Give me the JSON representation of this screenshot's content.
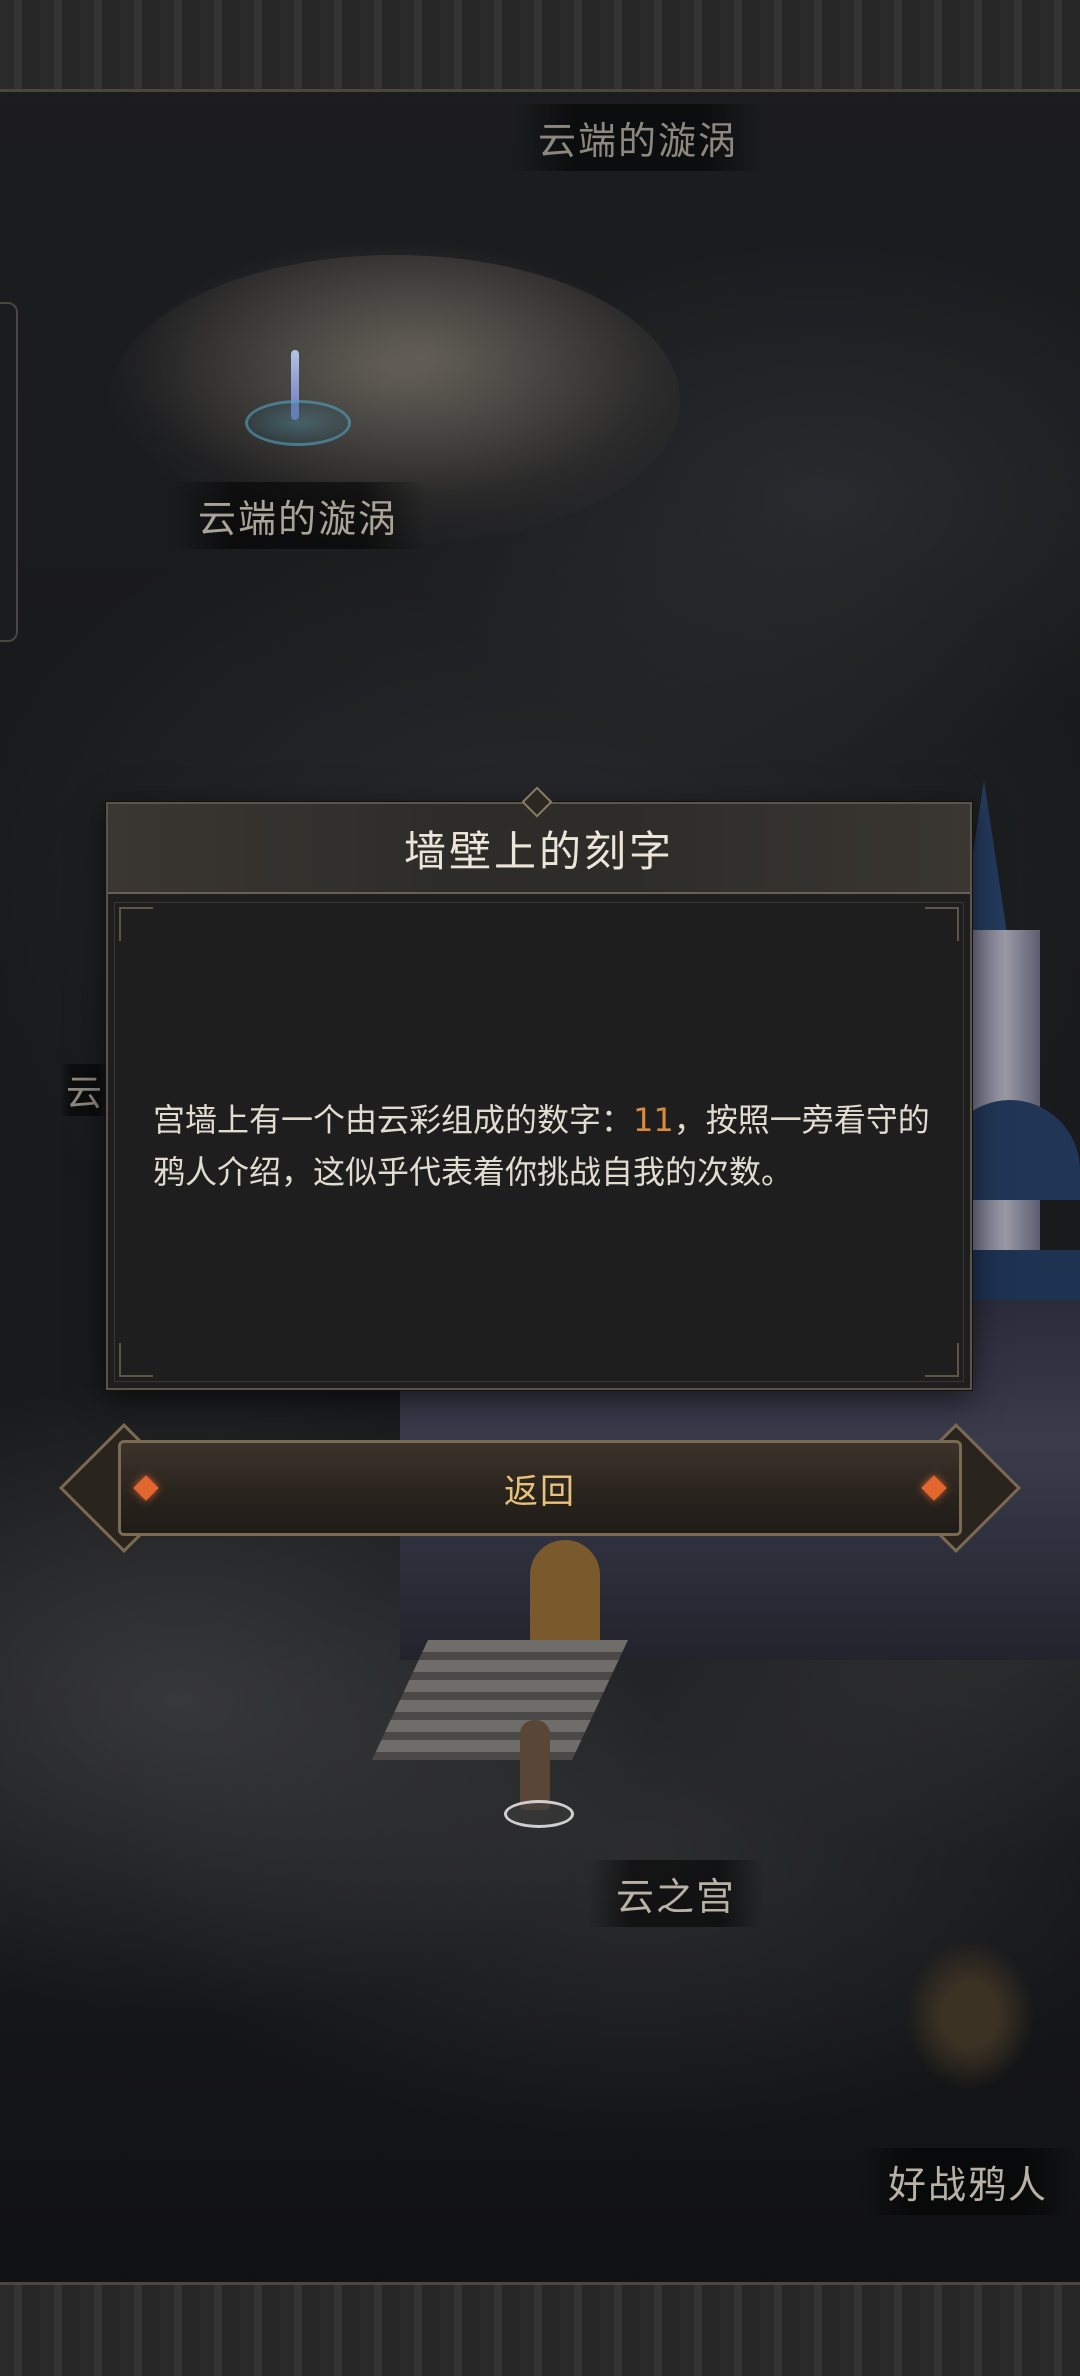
{
  "map": {
    "labels": {
      "top_location": "云端的漩涡",
      "vortex_location": "云端的漩涡",
      "partial_location": "云",
      "palace_location": "云之宫",
      "harpy_location": "好战鸦人"
    }
  },
  "dialog": {
    "title": "墙壁上的刻字",
    "text_before": "宫墙上有一个由云彩组成的数字：",
    "highlight_number": "11",
    "text_after": "，按照一旁看守的鸦人介绍，这似乎代表着你挑战自我的次数。",
    "highlight_color": "#d98a3a"
  },
  "actions": {
    "return_label": "返回"
  },
  "icons": {
    "portal": "vortex-portal-icon",
    "button_ornament": "diamond-gem-icon"
  }
}
